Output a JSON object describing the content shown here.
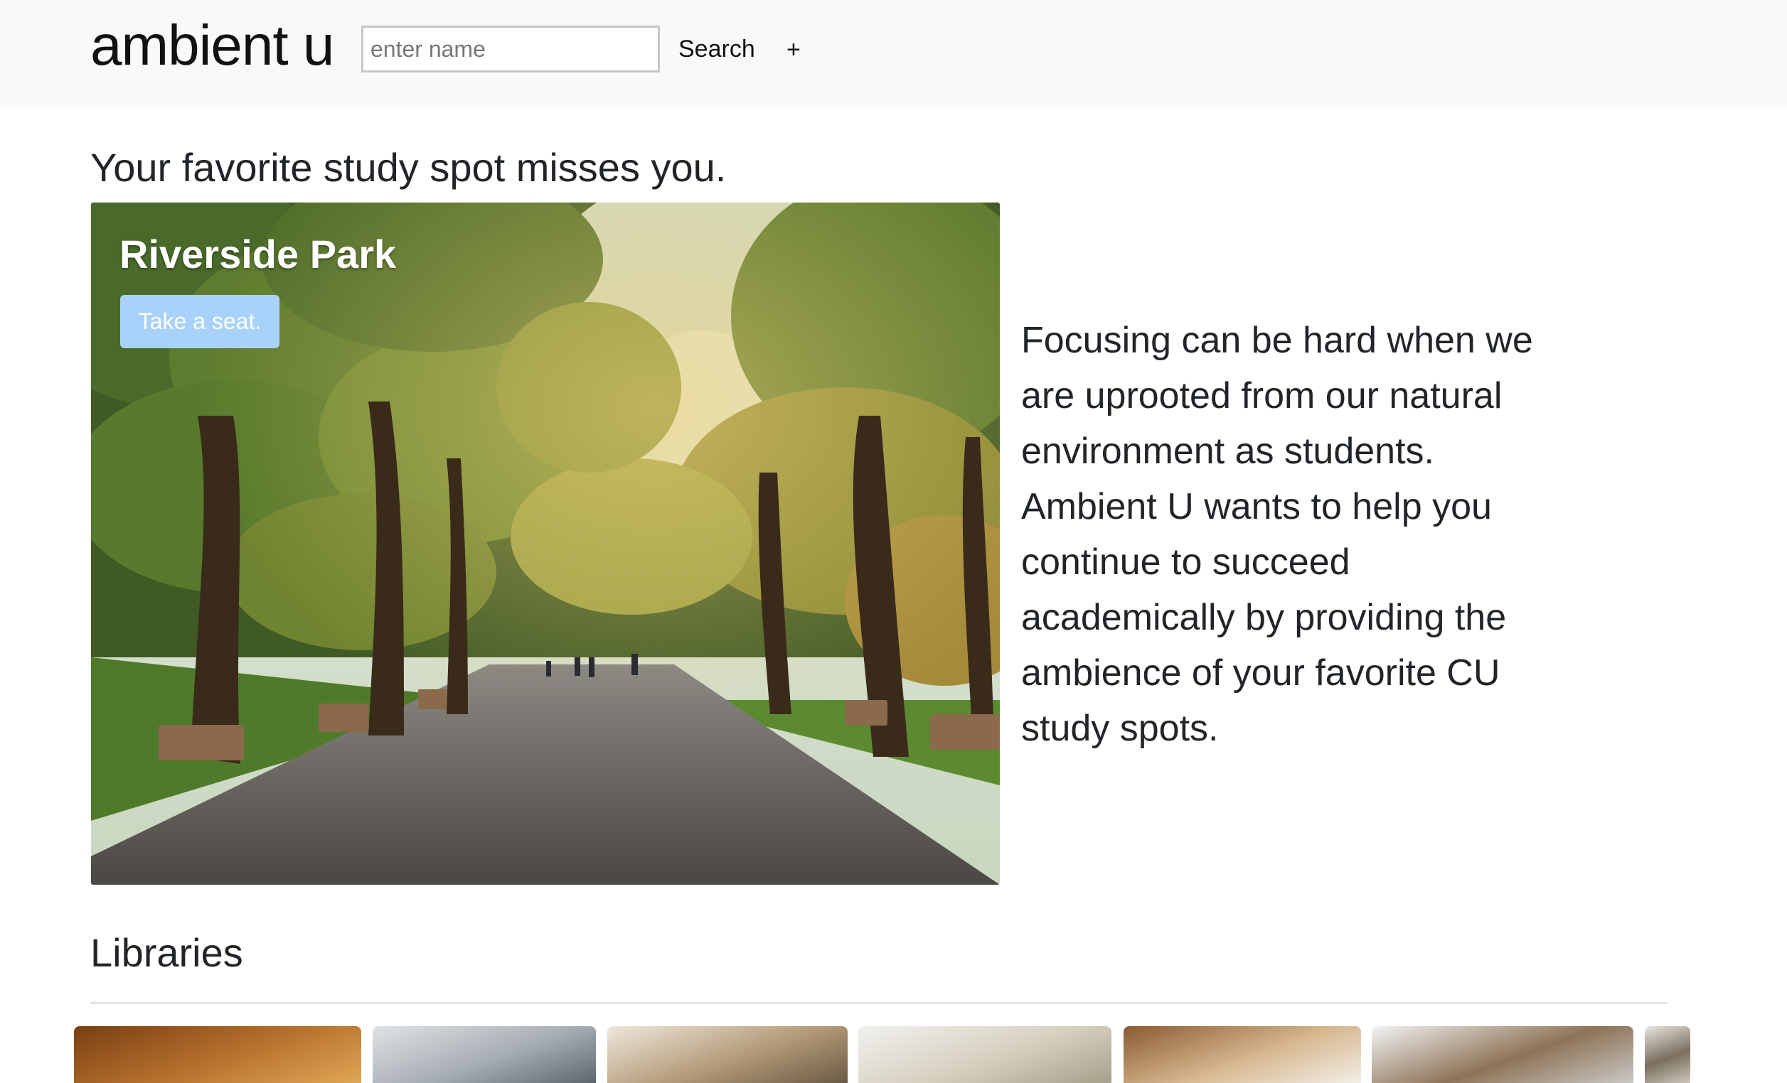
{
  "navbar": {
    "brand": "ambient u",
    "search_placeholder": "enter name",
    "search_label": "Search",
    "add_label": "+"
  },
  "main": {
    "headline": "Your favorite study spot misses you.",
    "featured": {
      "title": "Riverside Park",
      "button_label": "Take a seat."
    },
    "blurb": "Focusing can be hard when we are uprooted from our natural environment as students. Ambient U wants to help you continue to succeed academically by providing the ambience of your favorite CU study spots."
  },
  "libraries": {
    "title": "Libraries",
    "thumbnails": [
      {
        "name": "library-1",
        "palette": [
          "#7a3e12",
          "#b8732e",
          "#e0a656"
        ]
      },
      {
        "name": "library-2",
        "palette": [
          "#dfe3e6",
          "#a6adb3",
          "#5f666d"
        ]
      },
      {
        "name": "library-3",
        "palette": [
          "#efe8dc",
          "#b39a78",
          "#6b5a44"
        ]
      },
      {
        "name": "library-4",
        "palette": [
          "#f1f1ee",
          "#d6cfbf",
          "#a89f8a"
        ]
      },
      {
        "name": "library-5",
        "palette": [
          "#8a5a30",
          "#d7b890",
          "#f2efe8"
        ]
      },
      {
        "name": "library-6",
        "palette": [
          "#f3f4f4",
          "#8e7356",
          "#c9c9c6"
        ]
      },
      {
        "name": "library-7",
        "palette": [
          "#e9e6df",
          "#7a6f60",
          "#cfc8bb"
        ]
      }
    ]
  },
  "colors": {
    "navbar_bg": "#f8f9fa",
    "button_bg": "#a9d2fb",
    "text": "#212529"
  }
}
